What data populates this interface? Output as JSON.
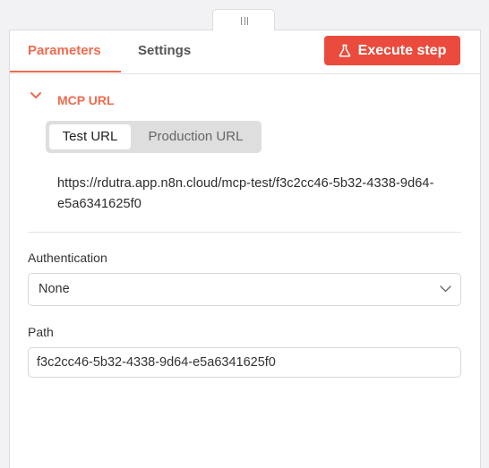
{
  "tabs": {
    "parameters_label": "Parameters",
    "settings_label": "Settings",
    "active": "Parameters"
  },
  "toolbar": {
    "execute_label": "Execute step",
    "execute_icon": "flask-icon"
  },
  "mcp_section": {
    "title": "MCP URL",
    "expanded": true,
    "url_options": [
      "Test URL",
      "Production URL"
    ],
    "selected_option": "Test URL",
    "url": "https://rdutra.app.n8n.cloud/mcp-test/f3c2cc46-5b32-4338-9d64-e5a6341625f0"
  },
  "authentication": {
    "label": "Authentication",
    "value": "None"
  },
  "path": {
    "label": "Path",
    "value": "f3c2cc46-5b32-4338-9d64-e5a6341625f0"
  },
  "colors": {
    "accent": "#ef6b4f",
    "execute_button": "#ea4b3c",
    "toggle_bg": "#dedede"
  }
}
